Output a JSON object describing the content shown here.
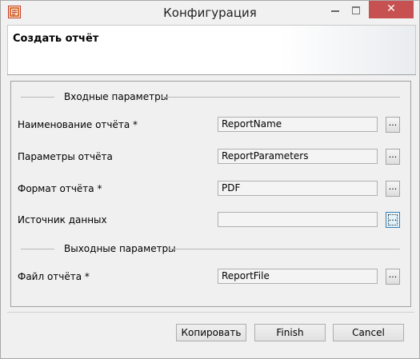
{
  "window": {
    "title": "Конфигурация",
    "close_glyph": "✕"
  },
  "header": {
    "title": "Создать отчёт"
  },
  "input_section": {
    "label": "Входные параметры"
  },
  "output_section": {
    "label": "Выходные параметры"
  },
  "fields": [
    {
      "label": "Наименование отчёта *",
      "value": "ReportName"
    },
    {
      "label": "Параметры отчёта",
      "value": "ReportParameters"
    },
    {
      "label": "Формат отчёта *",
      "value": "PDF"
    },
    {
      "label": "Источник данных",
      "value": ""
    },
    {
      "label": "Файл отчёта *",
      "value": "ReportFile"
    }
  ],
  "browse_label": "...",
  "buttons": {
    "copy": "Копировать",
    "finish": "Finish",
    "cancel": "Cancel"
  },
  "colors": {
    "close_button": "#c75050",
    "focus_border": "#3c7fb1"
  },
  "icons": {
    "app": "report-app-icon",
    "minimize": "minimize-icon",
    "maximize": "maximize-icon",
    "close": "close-icon"
  }
}
